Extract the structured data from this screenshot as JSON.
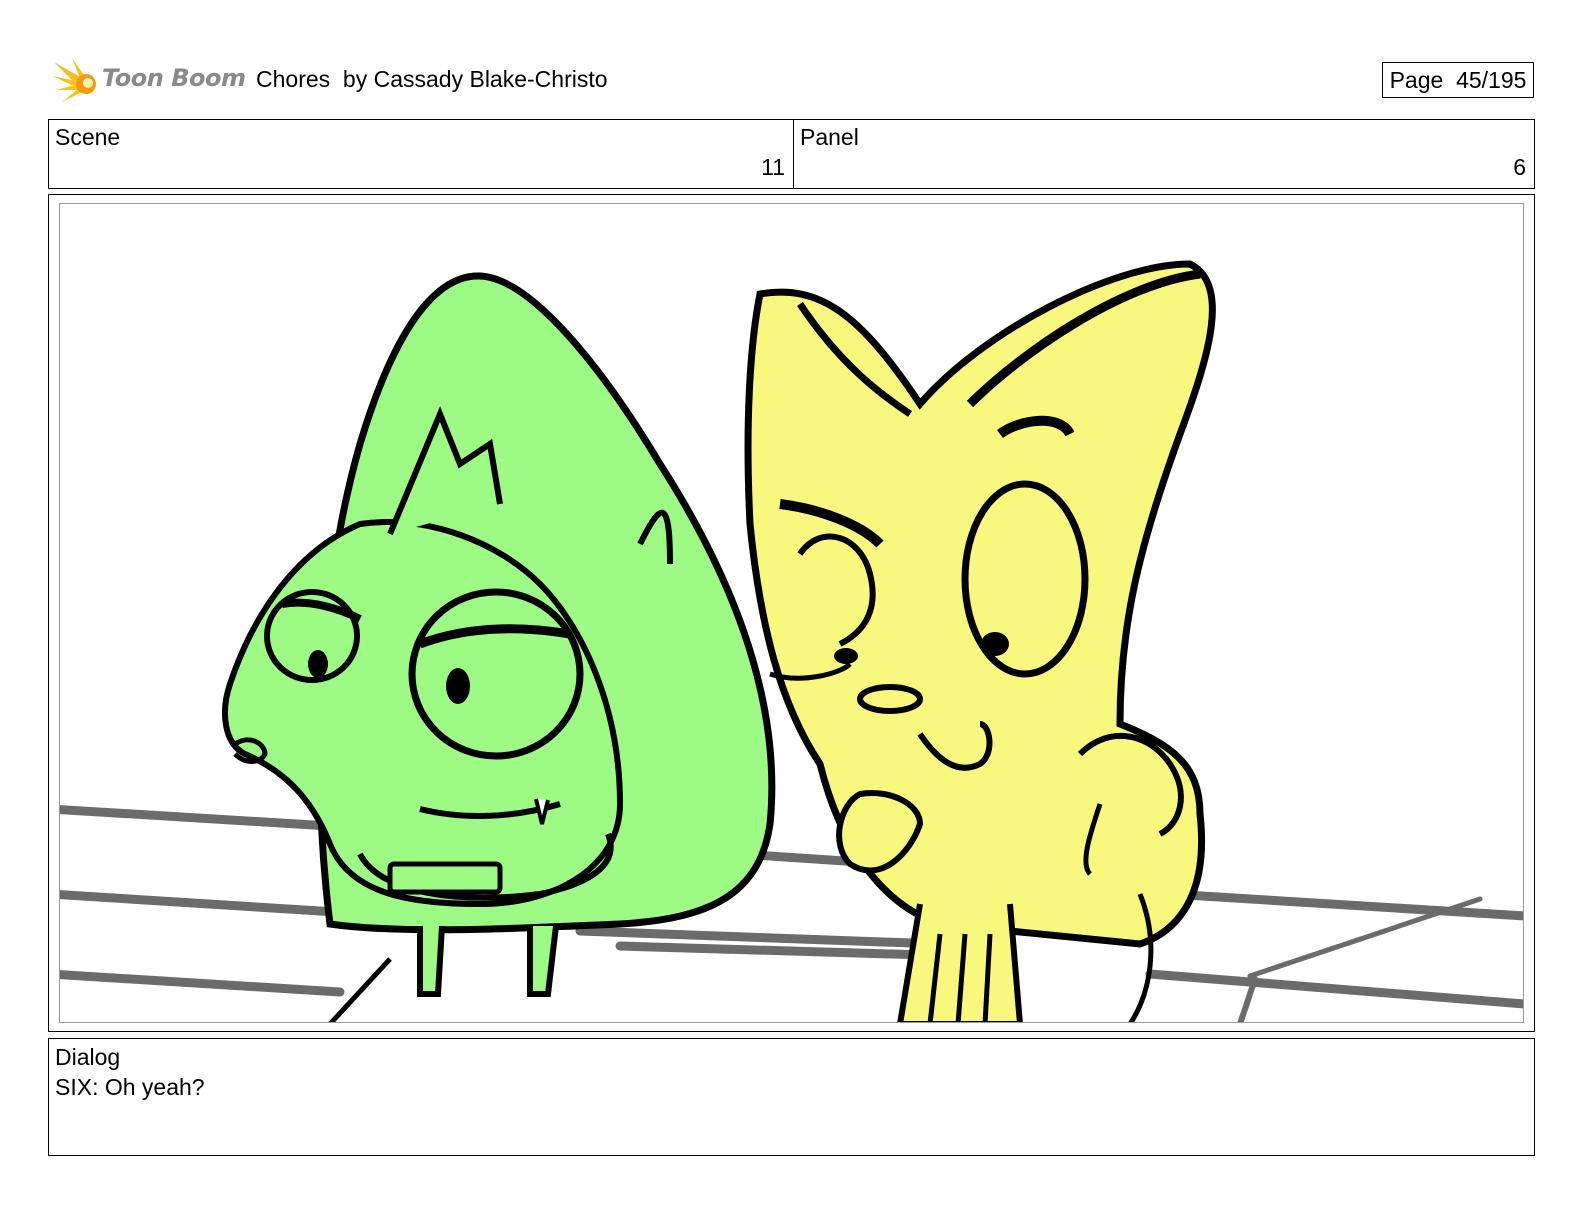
{
  "header": {
    "logo_text": "Toon Boom",
    "title": "Chores  by Cassady Blake-Christo",
    "page_label": "Page  45/195"
  },
  "info": {
    "scene_label": "Scene",
    "scene_value": "11",
    "panel_label": "Panel",
    "panel_value": "6"
  },
  "dialog": {
    "label": "Dialog",
    "text": "SIX: Oh yeah?"
  },
  "colors": {
    "green_character": "#9dfb85",
    "yellow_character": "#f8f87f",
    "railing": "#6b6b6b",
    "logo_yellow": "#f6c21a",
    "logo_text": "#8a8a8a"
  }
}
